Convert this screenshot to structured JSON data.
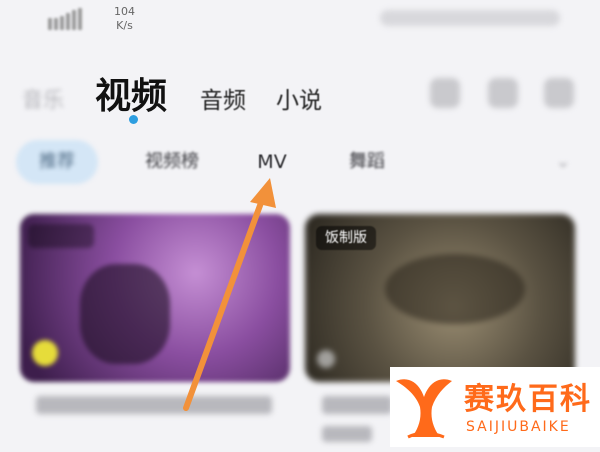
{
  "status_bar": {
    "network_speed": "104",
    "speed_unit": "K/s"
  },
  "top_tabs": [
    {
      "label": "音乐",
      "active": false
    },
    {
      "label": "视频",
      "active": true
    },
    {
      "label": "音频",
      "active": false
    },
    {
      "label": "小说",
      "active": false
    }
  ],
  "top_icons": [
    "search-icon",
    "grid-icon",
    "more-icon"
  ],
  "category_tabs": {
    "recommend": "推荐",
    "video_rank": "视频榜",
    "mv": "MV",
    "dance": "舞蹈",
    "other": "",
    "more": "⌄"
  },
  "cards": [
    {
      "badge": ""
    },
    {
      "badge": "饭制版"
    }
  ],
  "watermark": {
    "name": "赛玖百科",
    "latin": "SAIJIUBAIKE"
  },
  "colors": {
    "active_indicator": "#2d9ee0",
    "arrow": "#f2913a",
    "watermark": "#ff6a1a"
  }
}
